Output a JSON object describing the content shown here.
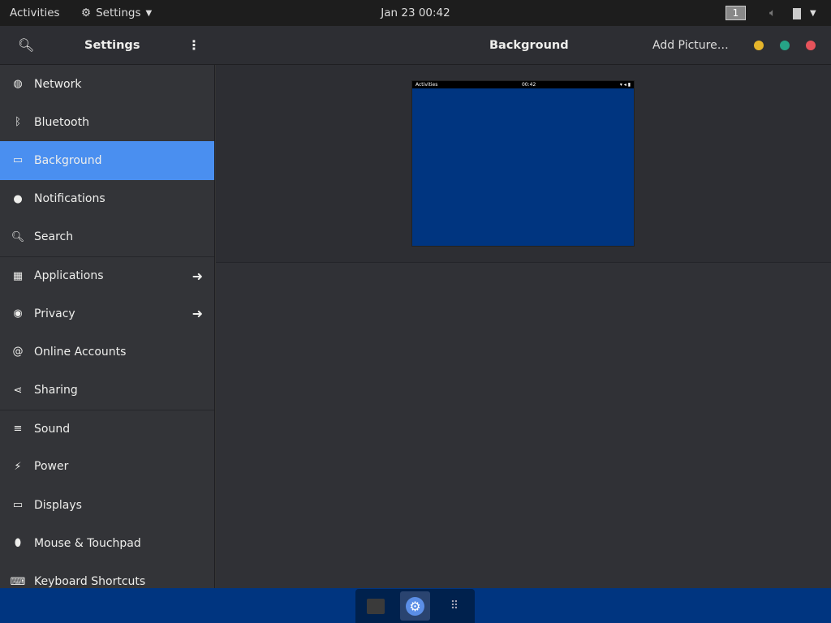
{
  "topbar": {
    "activities": "Activities",
    "app_menu": "Settings",
    "clock": "Jan 23  00:42",
    "workspace": "1"
  },
  "header": {
    "sidebar_title": "Settings",
    "page_title": "Background",
    "add_picture": "Add Picture…"
  },
  "sidebar": {
    "items": [
      {
        "label": "Network",
        "icon": "network-icon"
      },
      {
        "label": "Bluetooth",
        "icon": "bluetooth-icon"
      },
      {
        "label": "Background",
        "icon": "background-icon",
        "active": true
      },
      {
        "label": "Notifications",
        "icon": "notifications-icon"
      },
      {
        "label": "Search",
        "icon": "search-icon"
      },
      {
        "label": "Applications",
        "icon": "applications-icon",
        "arrow": true
      },
      {
        "label": "Privacy",
        "icon": "privacy-icon",
        "arrow": true
      },
      {
        "label": "Online Accounts",
        "icon": "online-accounts-icon"
      },
      {
        "label": "Sharing",
        "icon": "sharing-icon"
      },
      {
        "label": "Sound",
        "icon": "sound-icon"
      },
      {
        "label": "Power",
        "icon": "power-icon"
      },
      {
        "label": "Displays",
        "icon": "displays-icon"
      },
      {
        "label": "Mouse & Touchpad",
        "icon": "mouse-icon"
      },
      {
        "label": "Keyboard Shortcuts",
        "icon": "keyboard-icon"
      }
    ]
  },
  "preview": {
    "activities": "Activities",
    "clock": "00:42"
  },
  "colors": {
    "accent": "#4a8ff0",
    "wallpaper": "#003580",
    "minimize": "#e5b52b",
    "maximize": "#26a387",
    "close": "#e6535b"
  }
}
